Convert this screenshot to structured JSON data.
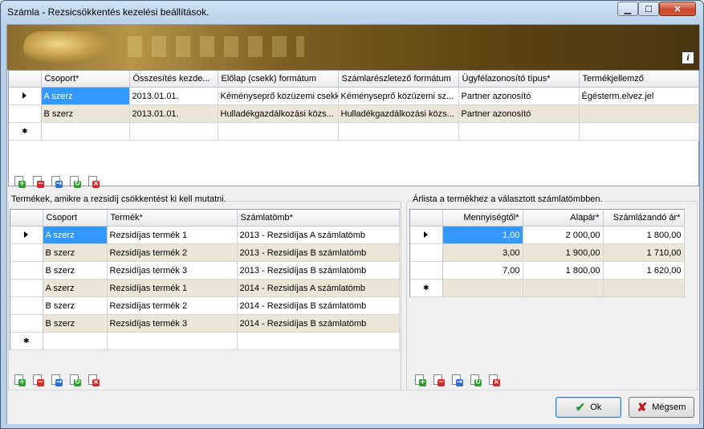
{
  "window": {
    "title": "Számla - Rezsicsökkentés kezelési beállítások.",
    "controls": {
      "minimize": "▁",
      "maximize": "☐",
      "close": "✕"
    }
  },
  "banner": {
    "info_icon": "i"
  },
  "top_grid": {
    "columns": [
      "Csoport*",
      "Összesítés kezde...",
      "Előlap (csekk) formátum",
      "Számlarészletező formátum",
      "Ügyfélazonosító típus*",
      "Termékjellemző"
    ],
    "rows": [
      [
        "A szerz",
        "2013.01.01.",
        "Kéményseprő közüzemi csekk",
        "Kéményseprő közüzemi sz...",
        "Partner azonosító",
        "Égésterm.elvez.jel"
      ],
      [
        "B szerz",
        "2013.01.01.",
        "Hulladékgazdálkozási közs...",
        "Hulladékgazdálkozási közs...",
        "Partner azonosító",
        ""
      ]
    ],
    "new_row_marker": "✱"
  },
  "products_group": {
    "label": "Termékek, amikre a rezsidíj csökkentést ki kell mutatni.",
    "columns": [
      "Csoport",
      "Termék*",
      "Számlatömb*"
    ],
    "rows": [
      [
        "A szerz",
        "Rezsidíjas termék 1",
        "2013 - Rezsidíjas A számlatömb"
      ],
      [
        "B szerz",
        "Rezsidíjas termék 2",
        "2013 - Rezsidíjas B számlatömb"
      ],
      [
        "B szerz",
        "Rezsidíjas termék 3",
        "2013 - Rezsidíjas B számlatömb"
      ],
      [
        "A szerz",
        "Rezsidíjas termék 1",
        "2014 - Rezsidíjas A számlatömb"
      ],
      [
        "B szerz",
        "Rezsidíjas termék 2",
        "2014 - Rezsidíjas B számlatömb"
      ],
      [
        "B szerz",
        "Rezsidíjas termék 3",
        "2014 - Rezsidíjas B számlatömb"
      ]
    ],
    "new_row_marker": "✱"
  },
  "price_group": {
    "label": "Árlista a termékhez a választott számlatömbben.",
    "columns": [
      "Mennyiségtől*",
      "Alapár*",
      "Számlázandó ár*"
    ],
    "rows": [
      [
        "1,00",
        "2 000,00",
        "1 800,00"
      ],
      [
        "3,00",
        "1 900,00",
        "1 710,00"
      ],
      [
        "7,00",
        "1 800,00",
        "1 620,00"
      ]
    ],
    "new_row_marker": "✱"
  },
  "toolbar_icons": [
    "add-row-icon",
    "delete-row-icon",
    "move-row-icon",
    "refresh-row-icon",
    "clear-row-icon"
  ],
  "buttons": {
    "ok": "Ok",
    "cancel": "Mégsem"
  },
  "colors": {
    "selection": "#3399ff",
    "alt_row": "#ece6d6"
  }
}
